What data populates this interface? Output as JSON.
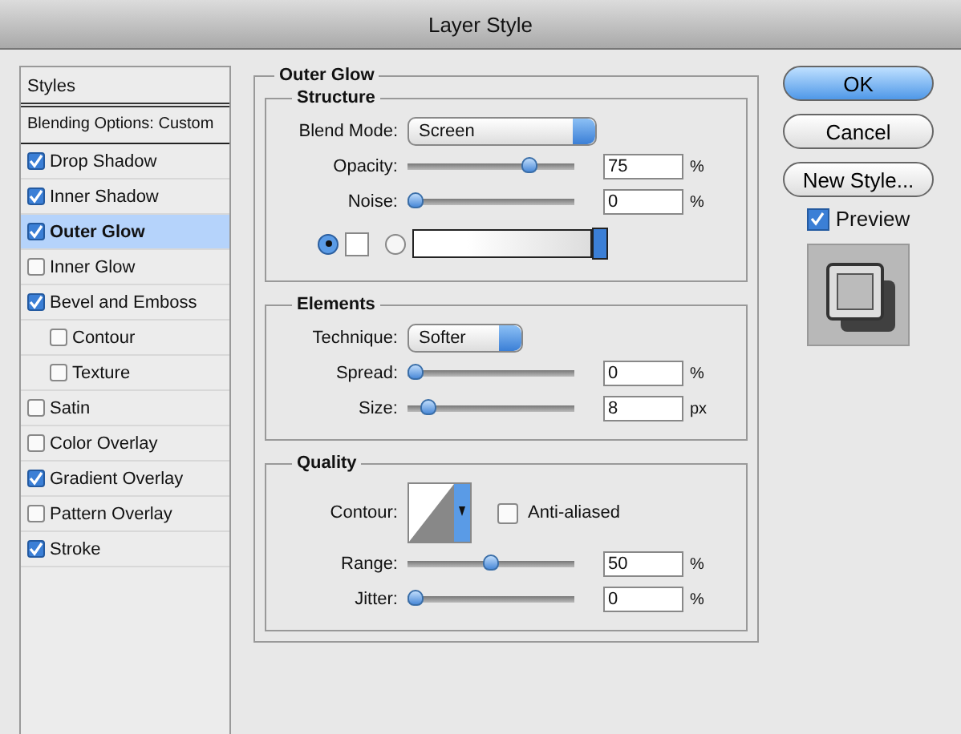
{
  "window": {
    "title": "Layer Style"
  },
  "sidebar": {
    "header": "Styles",
    "blending_options": "Blending Options: Custom",
    "items": [
      {
        "label": "Drop Shadow",
        "checked": true,
        "selected": false
      },
      {
        "label": "Inner Shadow",
        "checked": true,
        "selected": false
      },
      {
        "label": "Outer Glow",
        "checked": true,
        "selected": true
      },
      {
        "label": "Inner Glow",
        "checked": false,
        "selected": false
      },
      {
        "label": "Bevel and Emboss",
        "checked": true,
        "selected": false,
        "children": [
          {
            "label": "Contour",
            "checked": false,
            "selected": false
          },
          {
            "label": "Texture",
            "checked": false,
            "selected": false
          }
        ]
      },
      {
        "label": "Satin",
        "checked": false,
        "selected": false
      },
      {
        "label": "Color Overlay",
        "checked": false,
        "selected": false
      },
      {
        "label": "Gradient Overlay",
        "checked": true,
        "selected": false
      },
      {
        "label": "Pattern Overlay",
        "checked": false,
        "selected": false
      },
      {
        "label": "Stroke",
        "checked": true,
        "selected": false
      }
    ]
  },
  "panel": {
    "title": "Outer Glow",
    "structure": {
      "title": "Structure",
      "blend_mode": {
        "label": "Blend Mode:",
        "value": "Screen"
      },
      "sliders": [
        {
          "label": "Opacity:",
          "level": 0.75,
          "value": "75",
          "unit": "%"
        },
        {
          "label": "Noise:",
          "level": 0,
          "value": "0",
          "unit": "%"
        }
      ],
      "glow_source": [
        {
          "kind": "color",
          "selected": true
        },
        {
          "kind": "gradient",
          "selected": false
        }
      ]
    },
    "elements": {
      "title": "Elements",
      "technique": {
        "label": "Technique:",
        "value": "Softer"
      },
      "sliders": [
        {
          "label": "Spread:",
          "level": 0,
          "value": "0",
          "unit": "%"
        },
        {
          "label": "Size:",
          "level": 0.08,
          "value": "8",
          "unit": "px"
        }
      ]
    },
    "quality": {
      "title": "Quality",
      "contour_label": "Contour:",
      "anti_aliased": {
        "label": "Anti-aliased",
        "checked": false
      },
      "sliders": [
        {
          "label": "Range:",
          "level": 0.5,
          "value": "50",
          "unit": "%"
        },
        {
          "label": "Jitter:",
          "level": 0,
          "value": "0",
          "unit": "%"
        }
      ]
    }
  },
  "buttons": [
    {
      "label": "OK",
      "default": true
    },
    {
      "label": "Cancel",
      "default": false
    },
    {
      "label": "New Style...",
      "default": false
    }
  ],
  "preview": {
    "label": "Preview",
    "checked": true
  }
}
